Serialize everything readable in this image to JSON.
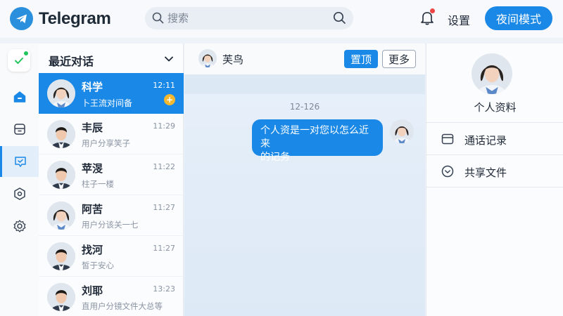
{
  "app": {
    "name": "Telegram"
  },
  "header": {
    "search_placeholder": "搜索",
    "settings_label": "设置",
    "night_mode_label": "夜间模式"
  },
  "chat_list": {
    "title": "最近对话",
    "items": [
      {
        "name": "科学",
        "time": "12:11",
        "preview": "卜王流对间备",
        "badge": "+",
        "active": true
      },
      {
        "name": "丰辰",
        "time": "11:29",
        "preview": "用户分享笑子"
      },
      {
        "name": "苹渂",
        "time": "11:22",
        "preview": "柱子一楼"
      },
      {
        "name": "阿苦",
        "time": "11:27",
        "preview": "用户分该关一七"
      },
      {
        "name": "找河",
        "time": "11:27",
        "preview": "皙于安心"
      },
      {
        "name": "刘耶",
        "time": "13:23",
        "preview": "直用户分镜文件大总等"
      }
    ]
  },
  "conversation": {
    "contact_name": "芙鸟",
    "pin_label": "置顶",
    "more_label": "更多",
    "date_label": "12-126",
    "messages": [
      {
        "text_line1": "个人资是一对您以怎么近来",
        "text_line2": "的记务"
      }
    ]
  },
  "profile": {
    "title": "个人资料",
    "rows": [
      {
        "label": "通话记录",
        "icon": "archive-icon"
      },
      {
        "label": "共享文件",
        "icon": "chevron-circle-icon"
      }
    ]
  },
  "colors": {
    "accent": "#1a88e6",
    "badge": "#f5b82e",
    "online": "#22c55e"
  }
}
